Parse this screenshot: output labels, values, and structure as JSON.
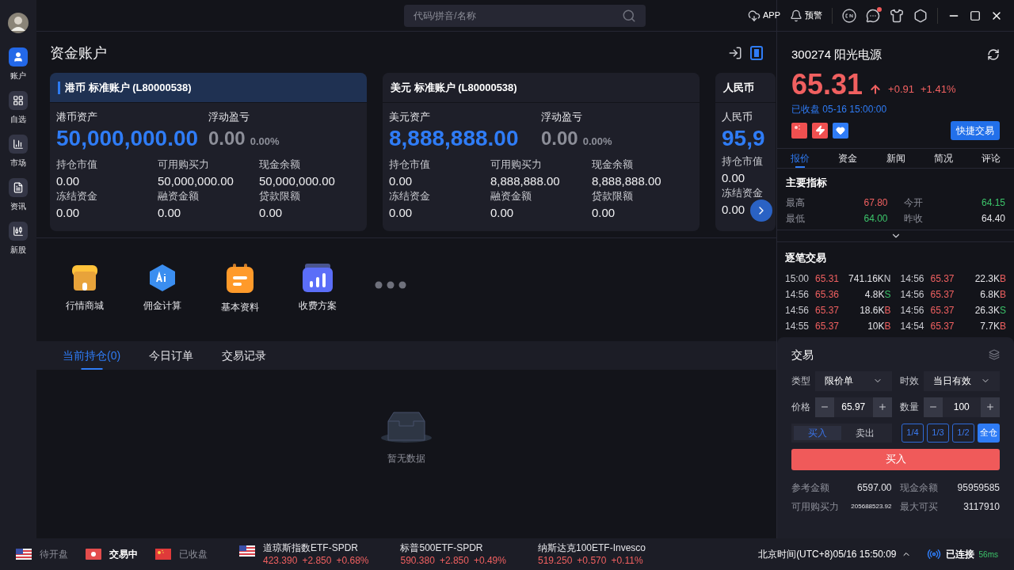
{
  "sidebar": {
    "items": [
      {
        "label": "账户",
        "kind": "account",
        "selected": true
      },
      {
        "label": "自选",
        "kind": "watchlist",
        "selected": false
      },
      {
        "label": "市场",
        "kind": "market",
        "selected": false
      },
      {
        "label": "资讯",
        "kind": "news",
        "selected": false
      },
      {
        "label": "新股",
        "kind": "ipo",
        "selected": false
      }
    ]
  },
  "topbar": {
    "search": {
      "placeholder": "代码/拼音/名称"
    },
    "app_label": "APP",
    "alert_label": "预警",
    "messages_unread": true
  },
  "account": {
    "title": "资金账户",
    "cards": [
      {
        "title": "港币 标准账户 (L80000538)",
        "selected": true,
        "asset_label": "港币资产",
        "asset_value": "50,000,000.00",
        "pnl_label": "浮动盈亏",
        "pnl_value": "0.00",
        "pnl_pct": "0.00%",
        "fields": [
          {
            "label": "持仓市值",
            "value": "0.00"
          },
          {
            "label": "可用购买力",
            "value": "50,000,000.00"
          },
          {
            "label": "现金余额",
            "value": "50,000,000.00"
          },
          {
            "label": "冻结资金",
            "value": "0.00"
          },
          {
            "label": "融资金额",
            "value": "0.00"
          },
          {
            "label": "贷款限额",
            "value": "0.00"
          }
        ]
      },
      {
        "title": "美元 标准账户 (L80000538)",
        "selected": false,
        "asset_label": "美元资产",
        "asset_value": "8,888,888.00",
        "pnl_label": "浮动盈亏",
        "pnl_value": "0.00",
        "pnl_pct": "0.00%",
        "fields": [
          {
            "label": "持仓市值",
            "value": "0.00"
          },
          {
            "label": "可用购买力",
            "value": "8,888,888.00"
          },
          {
            "label": "现金余额",
            "value": "8,888,888.00"
          },
          {
            "label": "冻结资金",
            "value": "0.00"
          },
          {
            "label": "融资金额",
            "value": "0.00"
          },
          {
            "label": "贷款限额",
            "value": "0.00"
          }
        ]
      },
      {
        "title": "人民币",
        "selected": false,
        "asset_label": "人民币",
        "asset_value": "95,9",
        "fields": [
          {
            "label": "持仓市值",
            "value": "0.00"
          },
          {
            "label": "冻结资金",
            "value": "0.00"
          }
        ]
      }
    ]
  },
  "shortcuts": [
    {
      "label": "行情商城",
      "kind": "store"
    },
    {
      "label": "佣金计算",
      "kind": "ai"
    },
    {
      "label": "基本资料",
      "kind": "profile"
    },
    {
      "label": "收费方案",
      "kind": "plan"
    }
  ],
  "holdings": {
    "tabs": [
      {
        "label": "当前持仓(0)",
        "selected": true
      },
      {
        "label": "今日订单",
        "selected": false
      },
      {
        "label": "交易记录",
        "selected": false
      }
    ],
    "empty_text": "暂无数据"
  },
  "quote": {
    "title": "300274 阳光电源",
    "price": "65.31",
    "change": "+0.91",
    "change_pct": "+1.41%",
    "status": "已收盘 05-16 15:00:00",
    "quick_trade": "快捷交易",
    "tabs": [
      {
        "label": "报价",
        "selected": true
      },
      {
        "label": "资金",
        "selected": false
      },
      {
        "label": "新闻",
        "selected": false
      },
      {
        "label": "简况",
        "selected": false
      },
      {
        "label": "评论",
        "selected": false
      }
    ],
    "indicators_title": "主要指标",
    "indicators": [
      {
        "label": "最高",
        "value": "67.80",
        "color": "#f06060"
      },
      {
        "label": "今开",
        "value": "64.15",
        "color": "#3cc46a"
      },
      {
        "label": "最低",
        "value": "64.00",
        "color": "#3cc46a"
      },
      {
        "label": "昨收",
        "value": "64.40",
        "color": "#e4e4e8"
      }
    ],
    "ticks_title": "逐笔交易",
    "ticks": [
      {
        "time": "15:00",
        "price": "65.31",
        "volume": "741.16K",
        "side": "N",
        "kind": "neutral"
      },
      {
        "time": "14:56",
        "price": "65.37",
        "volume": "22.3K",
        "side": "B",
        "kind": "buy"
      },
      {
        "time": "14:56",
        "price": "65.36",
        "volume": "4.8K",
        "side": "S",
        "kind": "sell"
      },
      {
        "time": "14:56",
        "price": "65.37",
        "volume": "6.8K",
        "side": "B",
        "kind": "buy"
      },
      {
        "time": "14:56",
        "price": "65.37",
        "volume": "18.6K",
        "side": "B",
        "kind": "buy"
      },
      {
        "time": "14:56",
        "price": "65.37",
        "volume": "26.3K",
        "side": "S",
        "kind": "sell"
      },
      {
        "time": "14:55",
        "price": "65.37",
        "volume": "10K",
        "side": "B",
        "kind": "buy"
      },
      {
        "time": "14:54",
        "price": "65.37",
        "volume": "7.7K",
        "side": "B",
        "kind": "buy"
      }
    ]
  },
  "trade": {
    "title": "交易",
    "type_label": "类型",
    "type_value": "限价单",
    "validity_label": "时效",
    "validity_value": "当日有效",
    "price_label": "价格",
    "price_value": "65.97",
    "qty_label": "数量",
    "qty_value": "100",
    "sides": [
      {
        "label": "买入",
        "selected": true
      },
      {
        "label": "卖出",
        "selected": false
      }
    ],
    "fractions": [
      {
        "label": "1/4",
        "selected": false
      },
      {
        "label": "1/3",
        "selected": false
      },
      {
        "label": "1/2",
        "selected": false
      },
      {
        "label": "全仓",
        "selected": true
      }
    ],
    "submit": "买入",
    "summary": [
      {
        "label": "参考金额",
        "value": "6597.00"
      },
      {
        "label": "现金余额",
        "value": "95959585"
      },
      {
        "label": "可用购买力",
        "value": "205688523.92",
        "small": true
      },
      {
        "label": "最大可买",
        "value": "3117910"
      }
    ]
  },
  "status_bar": {
    "markets": [
      {
        "kind": "us",
        "label": "待开盘",
        "active": false
      },
      {
        "kind": "hk",
        "label": "交易中",
        "active": true
      },
      {
        "kind": "cn",
        "label": "已收盘",
        "active": false
      }
    ],
    "tickers": [
      {
        "kind": "us",
        "name": "道琼斯指数ETF-SPDR",
        "price": "423.390",
        "change": "+2.850",
        "pct": "+0.68%"
      },
      {
        "kind": "plain",
        "name": "标普500ETF-SPDR",
        "price": "590.380",
        "change": "+2.850",
        "pct": "+0.49%"
      },
      {
        "kind": "plain",
        "name": "纳斯达克100ETF-Invesco",
        "price": "519.250",
        "change": "+0.570",
        "pct": "+0.11%"
      }
    ],
    "clock": "北京时间(UTC+8)05/16 15:50:09",
    "connection": "已连接",
    "latency": "56ms"
  }
}
